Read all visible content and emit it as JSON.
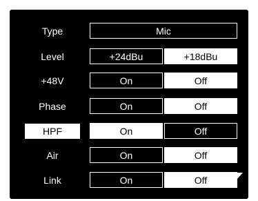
{
  "rows": [
    {
      "label": "Type",
      "options": [
        "Mic"
      ],
      "selected": 0
    },
    {
      "label": "Level",
      "options": [
        "+24dBu",
        "+18dBu"
      ],
      "selected": 1
    },
    {
      "label": "+48V",
      "options": [
        "On",
        "Off"
      ],
      "selected": 1
    },
    {
      "label": "Phase",
      "options": [
        "On",
        "Off"
      ],
      "selected": 1
    },
    {
      "label": "HPF",
      "options": [
        "On",
        "Off"
      ],
      "selected": 0,
      "focused": true
    },
    {
      "label": "Air",
      "options": [
        "On",
        "Off"
      ],
      "selected": 1
    },
    {
      "label": "Link",
      "options": [
        "On",
        "Off"
      ],
      "selected": 1
    }
  ],
  "scroll_indicator": "down-arrow-icon",
  "colors": {
    "background": "#000000",
    "foreground": "#ffffff"
  }
}
